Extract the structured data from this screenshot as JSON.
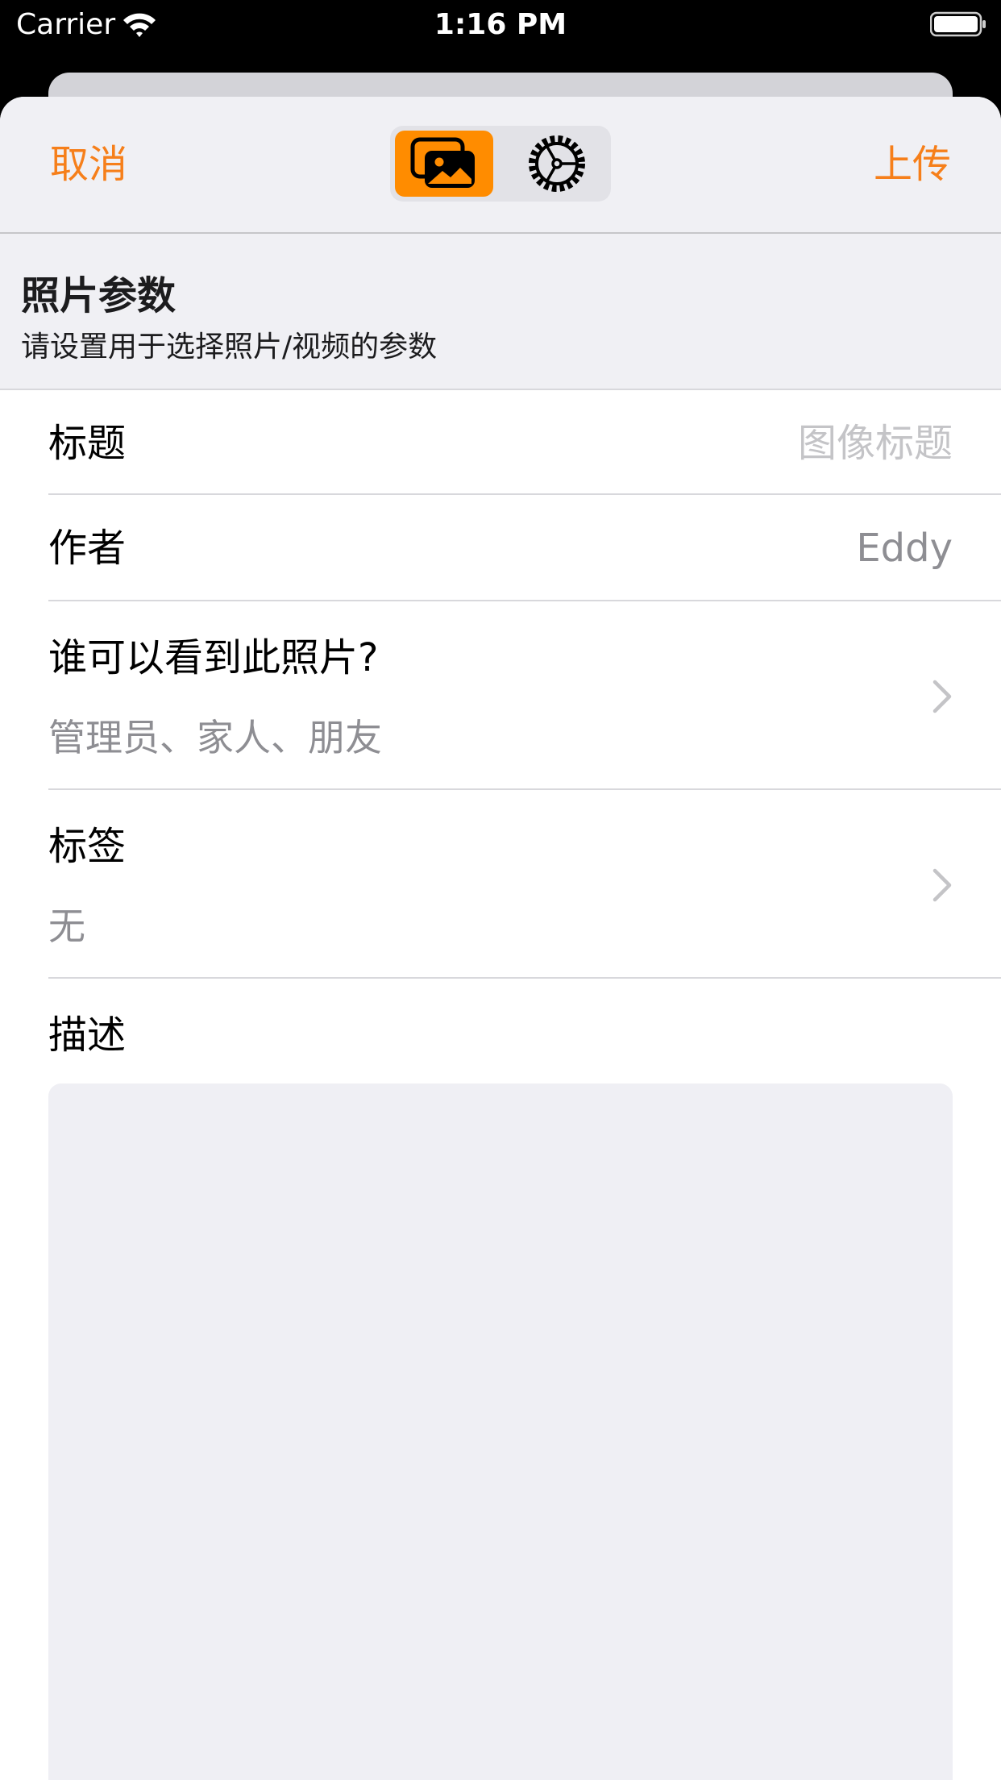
{
  "status_bar": {
    "carrier": "Carrier",
    "time": "1:16 PM"
  },
  "nav": {
    "cancel_label": "取消",
    "upload_label": "上传",
    "segments": [
      "photos-icon",
      "gear-icon"
    ],
    "selected_segment": 0
  },
  "section": {
    "title": "照片参数",
    "subtitle": "请设置用于选择照片/视频的参数"
  },
  "form": {
    "title_label": "标题",
    "title_placeholder": "图像标题",
    "author_label": "作者",
    "author_value": "Eddy",
    "privacy_label": "谁可以看到此照片?",
    "privacy_value": "管理员、家人、朋友",
    "tags_label": "标签",
    "tags_value": "无",
    "description_label": "描述"
  },
  "colors": {
    "accent": "#f67f1a",
    "segment_selected": "#ff8c00",
    "secondary_text": "#8e8e93",
    "placeholder_text": "#c4c4c7",
    "grouped_background": "#f0f0f4"
  }
}
